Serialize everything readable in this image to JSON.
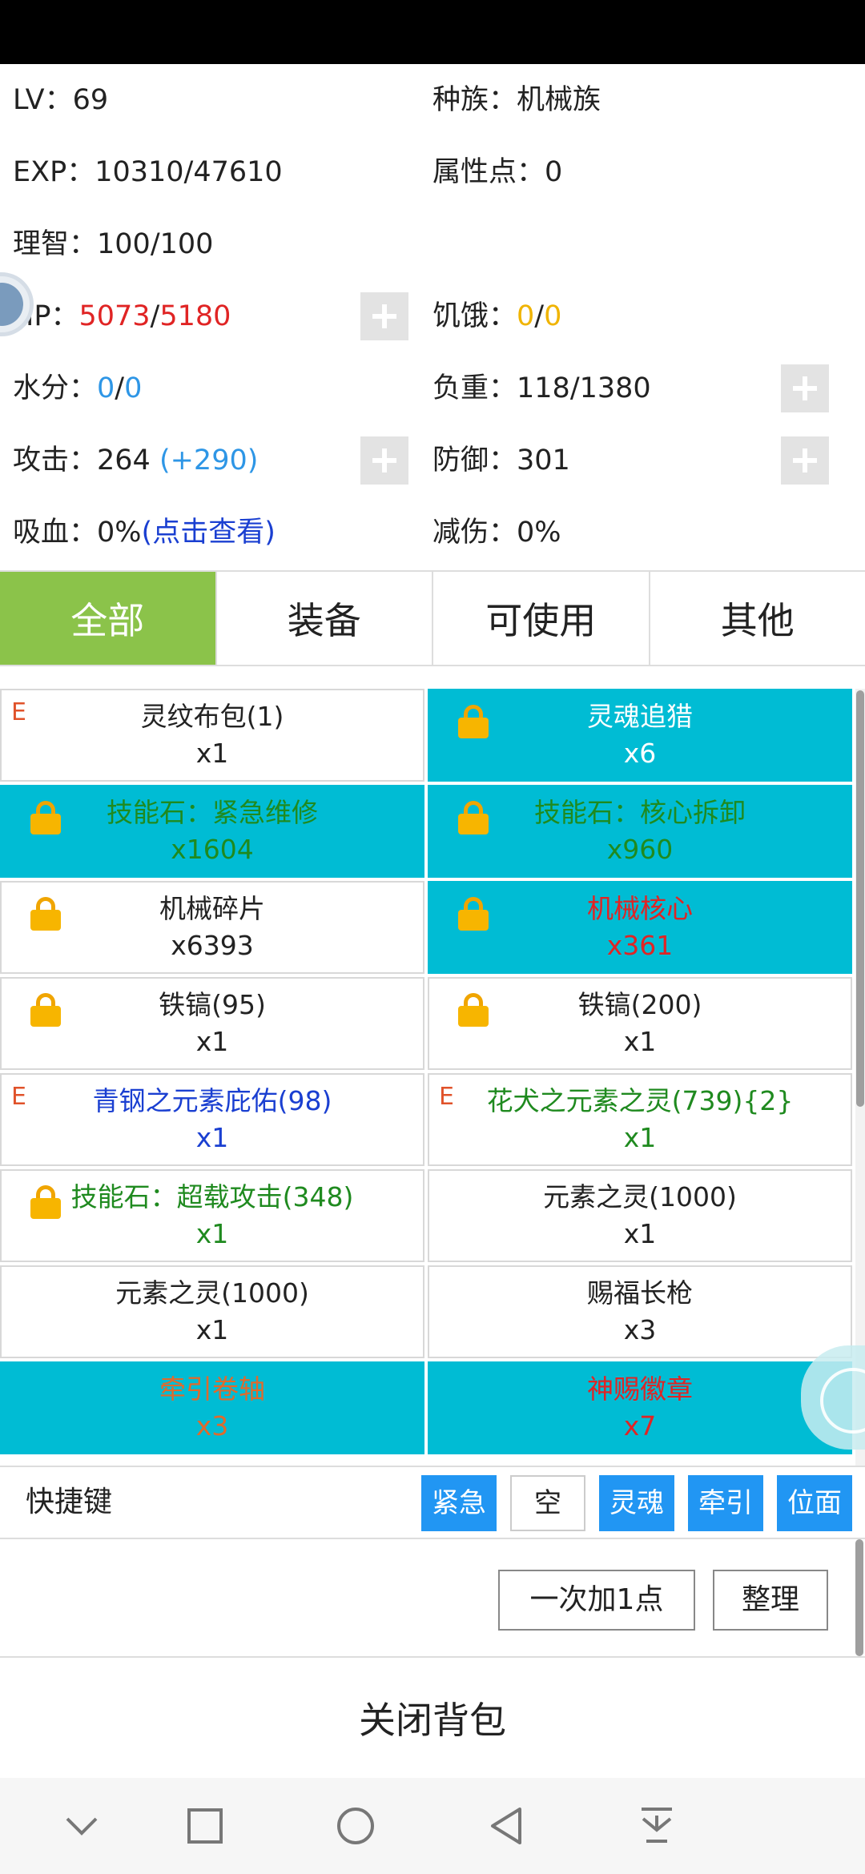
{
  "stats": {
    "lv_label": "LV：",
    "lv_value": "69",
    "race_label": "种族：",
    "race_value": "机械族",
    "exp_label": "EXP：",
    "exp_value": "10310/47610",
    "attr_label": "属性点：",
    "attr_value": "0",
    "sanity_label": "理智：",
    "sanity_value": "100/100",
    "hp_label": "HP：",
    "hp_current": "5073",
    "hp_sep": "/",
    "hp_max": "5180",
    "hunger_label": "饥饿：",
    "hunger_current": "0",
    "hunger_sep": "/",
    "hunger_max": "0",
    "water_label": "水分：",
    "water_current": "0",
    "water_sep": "/",
    "water_max": "0",
    "load_label": "负重：",
    "load_value": "118/1380",
    "attack_label": "攻击：",
    "attack_value": "264 ",
    "attack_bonus": "(+290)",
    "defense_label": "防御：",
    "defense_value": "301",
    "lifesteal_label": "吸血：",
    "lifesteal_value": "0%",
    "lifesteal_link": "(点击查看)",
    "dmg_reduce_label": "减伤：",
    "dmg_reduce_value": "0%"
  },
  "tabs": [
    {
      "label": "全部",
      "active": true
    },
    {
      "label": "装备",
      "active": false
    },
    {
      "label": "可使用",
      "active": false
    },
    {
      "label": "其他",
      "active": false
    }
  ],
  "items": [
    {
      "name": "灵纹布包(1)",
      "qty": "x1",
      "mark": "E",
      "locked": false,
      "highlight": false,
      "color": "black"
    },
    {
      "name": "灵魂追猎",
      "qty": "x6",
      "mark": "",
      "locked": true,
      "highlight": true,
      "color": "white"
    },
    {
      "name": "技能石：紧急维修",
      "qty": "x1604",
      "mark": "",
      "locked": true,
      "highlight": true,
      "color": "green"
    },
    {
      "name": "技能石：核心拆卸",
      "qty": "x960",
      "mark": "",
      "locked": true,
      "highlight": true,
      "color": "green"
    },
    {
      "name": "机械碎片",
      "qty": "x6393",
      "mark": "",
      "locked": true,
      "highlight": false,
      "color": "black"
    },
    {
      "name": "机械核心",
      "qty": "x361",
      "mark": "",
      "locked": true,
      "highlight": true,
      "color": "red"
    },
    {
      "name": "铁镐(95)",
      "qty": "x1",
      "mark": "",
      "locked": true,
      "highlight": false,
      "color": "black"
    },
    {
      "name": "铁镐(200)",
      "qty": "x1",
      "mark": "",
      "locked": true,
      "highlight": false,
      "color": "black"
    },
    {
      "name": "青钢之元素庇佑(98)",
      "qty": "x1",
      "mark": "E",
      "locked": false,
      "highlight": false,
      "color": "blue"
    },
    {
      "name": "花犬之元素之灵(739){2}",
      "qty": "x1",
      "mark": "E",
      "locked": false,
      "highlight": false,
      "color": "green"
    },
    {
      "name": "技能石：超载攻击(348)",
      "qty": "x1",
      "mark": "",
      "locked": true,
      "highlight": false,
      "color": "green"
    },
    {
      "name": "元素之灵(1000)",
      "qty": "x1",
      "mark": "",
      "locked": false,
      "highlight": false,
      "color": "black"
    },
    {
      "name": "元素之灵(1000)",
      "qty": "x1",
      "mark": "",
      "locked": false,
      "highlight": false,
      "color": "black"
    },
    {
      "name": "赐福长枪",
      "qty": "x3",
      "mark": "",
      "locked": false,
      "highlight": false,
      "color": "black"
    },
    {
      "name": "牵引卷轴",
      "qty": "x3",
      "mark": "",
      "locked": false,
      "highlight": true,
      "color": "orange"
    },
    {
      "name": "神赐徽章",
      "qty": "x7",
      "mark": "",
      "locked": false,
      "highlight": true,
      "color": "red"
    }
  ],
  "quick_bar": {
    "label": "快捷键",
    "slots": [
      {
        "label": "紧急",
        "filled": true
      },
      {
        "label": "空",
        "filled": false
      },
      {
        "label": "灵魂",
        "filled": true
      },
      {
        "label": "牵引",
        "filled": true
      },
      {
        "label": "位面",
        "filled": true
      }
    ]
  },
  "actions": {
    "add_one": "一次加1点",
    "sort": "整理"
  },
  "close_label": "关闭背包",
  "colors": {
    "tab_active": "#8bc34a",
    "item_highlight": "#00bcd4",
    "quick_slot": "#2196f3",
    "hp_red": "#e02424",
    "hunger_yellow": "#f0b400",
    "water_blue": "#2e96e6"
  },
  "nav_icons": [
    "chevron-down-icon",
    "square-icon",
    "circle-icon",
    "triangle-back-icon",
    "download-tray-icon"
  ]
}
